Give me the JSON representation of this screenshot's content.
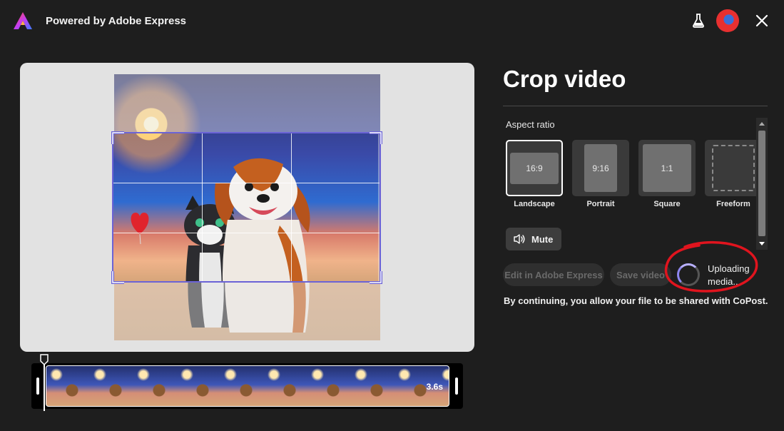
{
  "header": {
    "brand": "Powered by Adobe Express",
    "logo_icon": "adobe-express-logo",
    "labs_icon": "flask-icon",
    "avatar_icon": "user-avatar",
    "close_icon": "close-icon"
  },
  "panel": {
    "title": "Crop video",
    "aspect_ratio_label": "Aspect ratio",
    "ratios": [
      {
        "shape_label": "16:9",
        "name": "Landscape",
        "selected": true
      },
      {
        "shape_label": "9:16",
        "name": "Portrait",
        "selected": false
      },
      {
        "shape_label": "1:1",
        "name": "Square",
        "selected": false
      },
      {
        "shape_label": "",
        "name": "Freeform",
        "selected": false
      }
    ],
    "mute_label": "Mute",
    "edit_button": "Edit in Adobe Express",
    "save_button": "Save video",
    "uploading_text": "Uploading media...",
    "consent_text": "By continuing, you allow your file to be shared with CoPost."
  },
  "timeline": {
    "duration": "3.6s"
  },
  "colors": {
    "background": "#1e1e1e",
    "crop_border": "#6b63d6",
    "annotation": "#e0141e",
    "selected_card_border": "#ffffff"
  }
}
